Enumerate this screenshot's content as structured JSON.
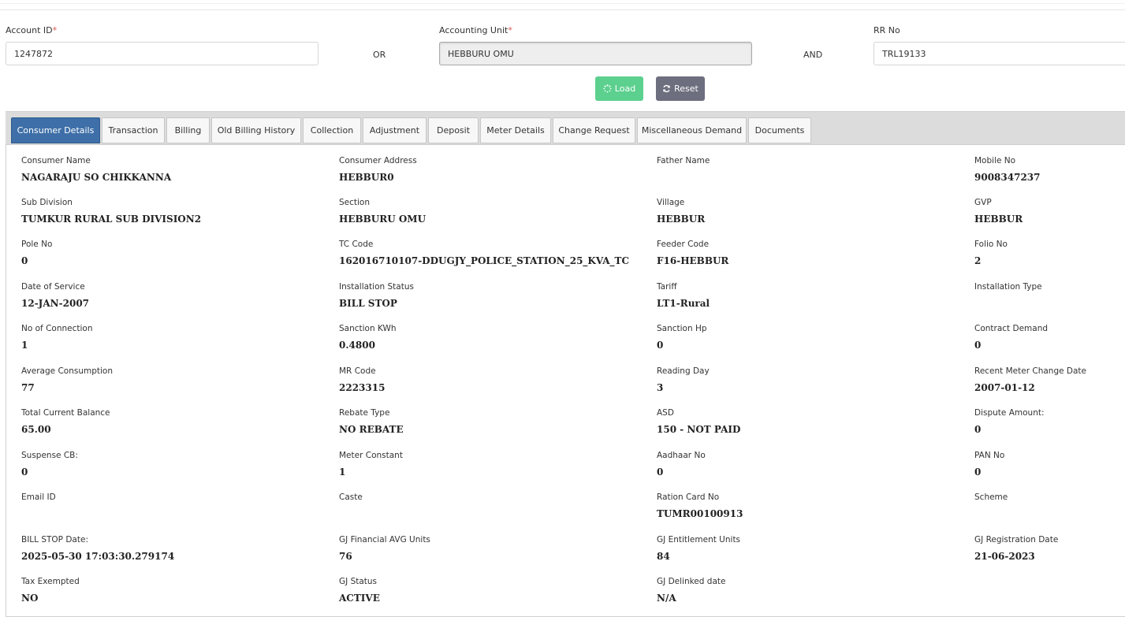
{
  "search": {
    "account_id_label": "Account ID",
    "account_id_value": "1247872",
    "or_text": "OR",
    "accounting_unit_label": "Accounting Unit",
    "accounting_unit_value": "HEBBURU OMU",
    "and_text": "AND",
    "rr_no_label": "RR No",
    "rr_no_value": "TRL19133",
    "required_marker": "*"
  },
  "actions": {
    "load_label": "Load",
    "reset_label": "Reset",
    "load_color": "#5cd08e",
    "reset_color": "#6d6e7e"
  },
  "tabs": [
    {
      "label": "Consumer Details",
      "active": true
    },
    {
      "label": "Transaction"
    },
    {
      "label": "Billing"
    },
    {
      "label": "Old Billing History"
    },
    {
      "label": "Collection"
    },
    {
      "label": "Adjustment"
    },
    {
      "label": "Deposit"
    },
    {
      "label": "Meter Details"
    },
    {
      "label": "Change Request"
    },
    {
      "label": "Miscellaneous Demand"
    },
    {
      "label": "Documents"
    }
  ],
  "details": {
    "rows": [
      [
        {
          "label": "Consumer Name",
          "value": "NAGARAJU SO CHIKKANNA"
        },
        {
          "label": "Consumer Address",
          "value": "HEBBUR0"
        },
        {
          "label": "Father Name",
          "value": ""
        },
        {
          "label": "Mobile No",
          "value": "9008347237"
        }
      ],
      [
        {
          "label": "Sub Division",
          "value": "TUMKUR RURAL SUB DIVISION2"
        },
        {
          "label": "Section",
          "value": "HEBBURU OMU"
        },
        {
          "label": "Village",
          "value": "HEBBUR"
        },
        {
          "label": "GVP",
          "value": "HEBBUR"
        }
      ],
      [
        {
          "label": "Pole No",
          "value": "0"
        },
        {
          "label": "TC Code",
          "value": "162016710107-DDUGJY_POLICE_STATION_25_KVA_TC"
        },
        {
          "label": "Feeder Code",
          "value": "F16-HEBBUR"
        },
        {
          "label": "Folio No",
          "value": "2"
        }
      ],
      [
        {
          "label": "Date of Service",
          "value": "12-JAN-2007"
        },
        {
          "label": "Installation Status",
          "value": "BILL STOP"
        },
        {
          "label": "Tariff",
          "value": "LT1-Rural"
        },
        {
          "label": "Installation Type",
          "value": ""
        }
      ],
      [
        {
          "label": "No of Connection",
          "value": "1"
        },
        {
          "label": "Sanction KWh",
          "value": "0.4800"
        },
        {
          "label": "Sanction Hp",
          "value": "0"
        },
        {
          "label": "Contract Demand",
          "value": "0"
        }
      ],
      [
        {
          "label": "Average Consumption",
          "value": "77"
        },
        {
          "label": "MR Code",
          "value": "2223315"
        },
        {
          "label": "Reading Day",
          "value": "3"
        },
        {
          "label": "Recent Meter Change Date",
          "value": "2007-01-12"
        }
      ],
      [
        {
          "label": "Total Current Balance",
          "value": "65.00"
        },
        {
          "label": "Rebate Type",
          "value": "NO REBATE"
        },
        {
          "label": "ASD",
          "value": "150 - NOT PAID"
        },
        {
          "label": "Dispute Amount:",
          "value": "0"
        }
      ],
      [
        {
          "label": "Suspense CB:",
          "value": "0"
        },
        {
          "label": "Meter Constant",
          "value": "1"
        },
        {
          "label": "Aadhaar No",
          "value": "0"
        },
        {
          "label": "PAN No",
          "value": "0"
        }
      ],
      [
        {
          "label": "Email ID",
          "value": ""
        },
        {
          "label": "Caste",
          "value": ""
        },
        {
          "label": "Ration Card No",
          "value": "TUMR00100913"
        },
        {
          "label": "Scheme",
          "value": ""
        }
      ],
      [
        {
          "label": "BILL STOP Date:",
          "value": "2025-05-30 17:03:30.279174"
        },
        {
          "label": "GJ Financial AVG Units",
          "value": "76"
        },
        {
          "label": "GJ Entitlement Units",
          "value": "84"
        },
        {
          "label": "GJ Registration Date",
          "value": "21-06-2023"
        }
      ],
      [
        {
          "label": "Tax Exempted",
          "value": "NO"
        },
        {
          "label": "GJ Status",
          "value": "ACTIVE"
        },
        {
          "label": "GJ Delinked date",
          "value": "N/A"
        },
        {
          "label": "",
          "value": ""
        }
      ]
    ]
  }
}
